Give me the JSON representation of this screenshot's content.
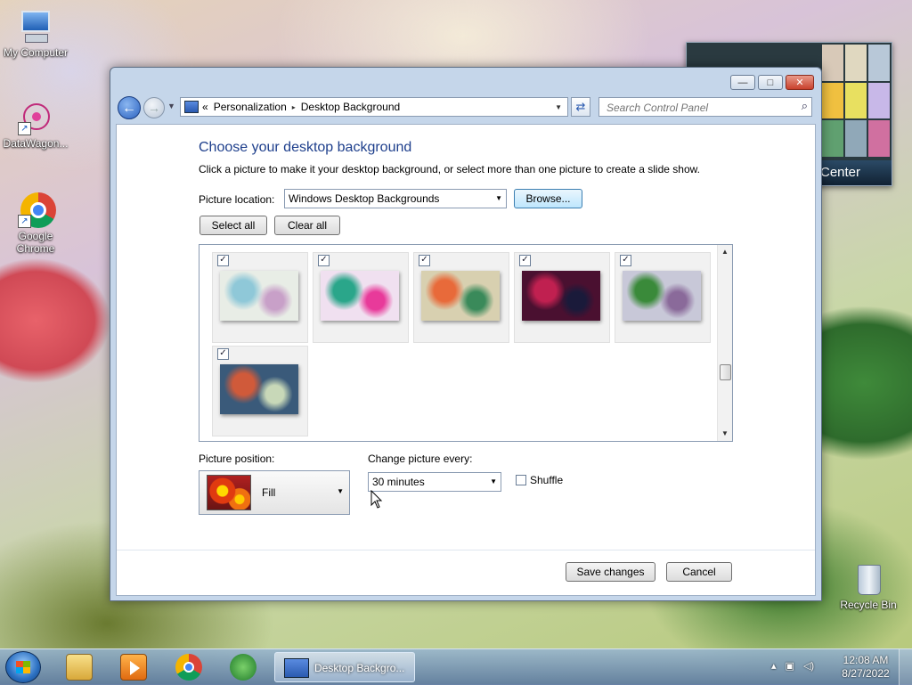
{
  "desktop": {
    "icons": [
      {
        "label": "My Computer"
      },
      {
        "label": "DataWagon..."
      },
      {
        "label": "Google Chrome"
      },
      {
        "label": "Recycle Bin"
      }
    ],
    "gadget_label": "Center"
  },
  "window": {
    "buttons": {
      "minimize": "—",
      "maximize": "□",
      "close": "✕"
    },
    "address": {
      "prefix": "«",
      "crumbs": [
        "Personalization",
        "Desktop Background"
      ],
      "separator": "▸",
      "dropdown": "▼"
    },
    "refresh_icon": "⇄",
    "search": {
      "placeholder": "Search Control Panel",
      "icon": "⌕"
    },
    "heading": "Choose your desktop background",
    "subtext": "Click a picture to make it your desktop background, or select more than one picture to create a slide show.",
    "picture_location": {
      "label": "Picture location:",
      "value": "Windows Desktop Backgrounds",
      "browse": "Browse..."
    },
    "select_all": "Select all",
    "clear_all": "Clear all",
    "thumbnails": [
      {
        "checked": true,
        "colors": [
          "#e8ede6",
          "#8fc8d8",
          "#c8a0c8"
        ]
      },
      {
        "checked": true,
        "colors": [
          "#f0e0f0",
          "#2aa68a",
          "#e83a9a"
        ]
      },
      {
        "checked": true,
        "colors": [
          "#d8d0b0",
          "#e86a3a",
          "#3a8a5a"
        ]
      },
      {
        "checked": true,
        "colors": [
          "#4a1030",
          "#c02050",
          "#1a1a3a"
        ]
      },
      {
        "checked": true,
        "colors": [
          "#c8c8d8",
          "#3a8a3a",
          "#8a6a9a"
        ]
      },
      {
        "checked": true,
        "colors": [
          "#3a5a7a",
          "#d05a3a",
          "#c8d8b8"
        ]
      }
    ],
    "check_glyph": "✓",
    "scroll": {
      "up": "▲",
      "down": "▼"
    },
    "picture_position": {
      "label": "Picture position:",
      "value": "Fill",
      "arrow": "▼"
    },
    "change_picture": {
      "label": "Change picture every:",
      "value": "30 minutes",
      "arrow": "▼"
    },
    "shuffle": {
      "label": "Shuffle",
      "checked": false
    },
    "save": "Save changes",
    "cancel": "Cancel"
  },
  "taskbar": {
    "active_task": "Desktop Backgro...",
    "tray_icons": [
      "▴",
      "▣",
      "◁)"
    ],
    "time": "12:08 AM",
    "date": "8/27/2022"
  }
}
